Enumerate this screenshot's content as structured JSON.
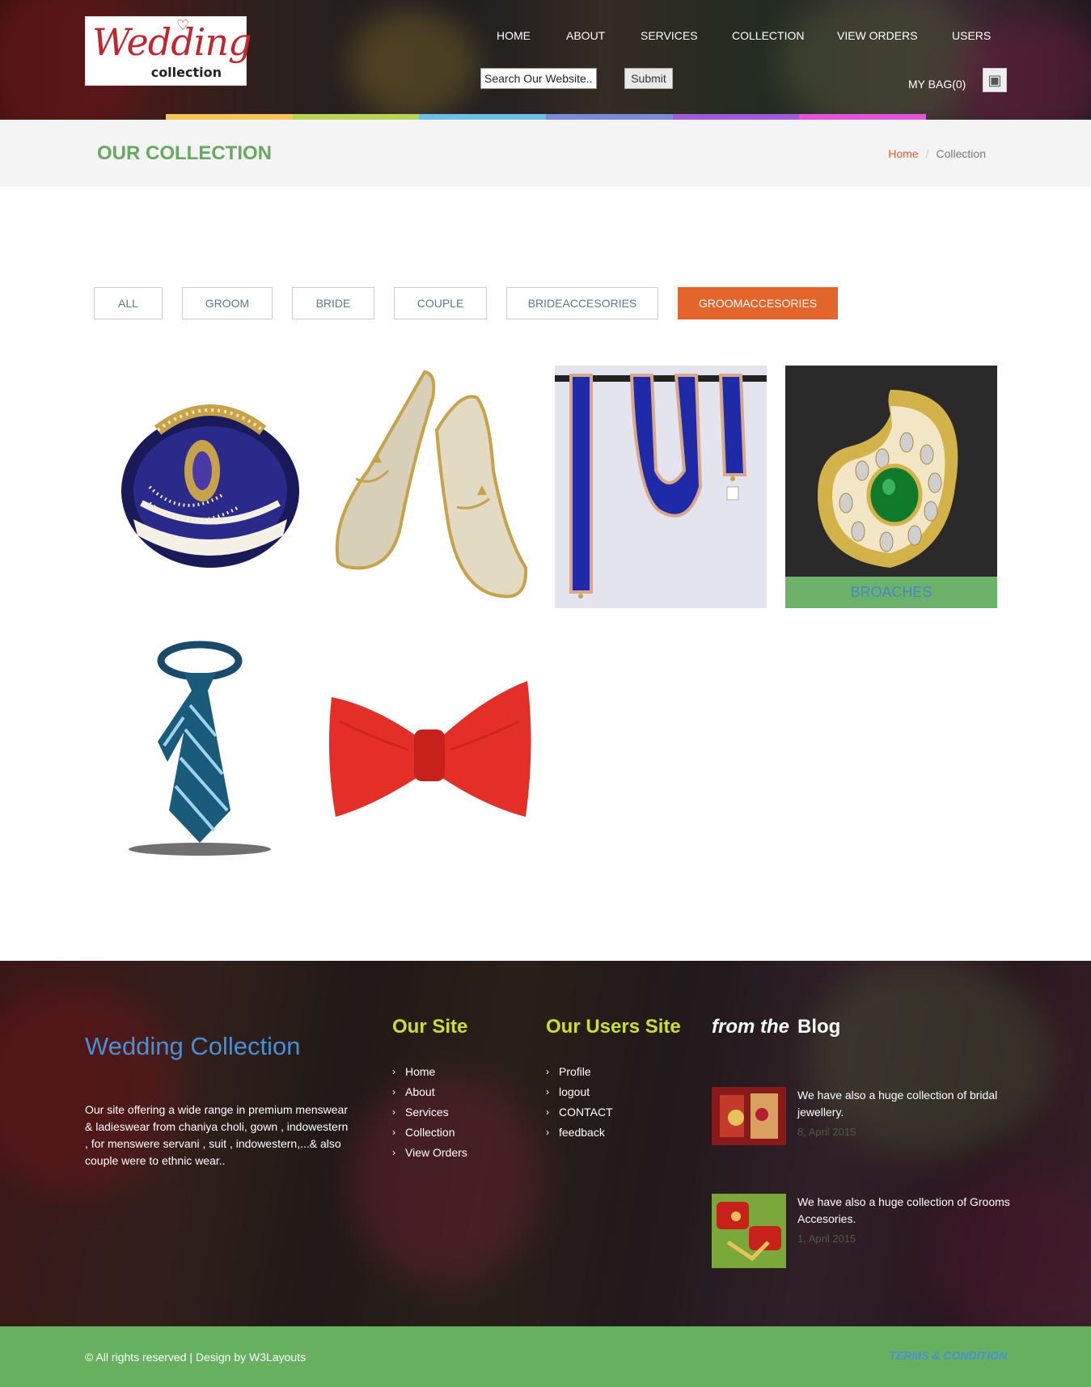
{
  "header": {
    "logo_text": "Wedding",
    "logo_subtext": "collection",
    "nav": [
      {
        "label": "HOME"
      },
      {
        "label": "ABOUT"
      },
      {
        "label": "SERVICES"
      },
      {
        "label": "COLLECTION"
      },
      {
        "label": "VIEW ORDERS"
      },
      {
        "label": "USERS"
      }
    ],
    "search_placeholder": "Search Our Website...",
    "submit_label": "Submit",
    "bag_label": "MY BAG(0)",
    "strip_colors": [
      "#f5c55b",
      "#b8d356",
      "#6cc0e8",
      "#7b8bd8",
      "#a05bd6",
      "#e156d6"
    ]
  },
  "title_bar": {
    "title": "OUR COLLECTION",
    "breadcrumb": {
      "home": "Home",
      "separator": "/",
      "current": "Collection"
    }
  },
  "filters": [
    {
      "label": "ALL",
      "active": false
    },
    {
      "label": "GROOM",
      "active": false
    },
    {
      "label": "BRIDE",
      "active": false
    },
    {
      "label": "COUPLE",
      "active": false
    },
    {
      "label": "BRIDEACCESORIES",
      "active": false
    },
    {
      "label": "GROOMACCESORIES",
      "active": true
    }
  ],
  "products": [
    {
      "name": "turban-image"
    },
    {
      "name": "mojari-shoes-image"
    },
    {
      "name": "velvet-stole-image"
    },
    {
      "name": "broach-image",
      "caption": "BROACHES"
    },
    {
      "name": "tie-image"
    },
    {
      "name": "bow-tie-image"
    }
  ],
  "footer": {
    "brand": "Wedding Collection",
    "about": "Our site offering a wide range in premium menswear & ladieswear from chaniya choli, gown , indowestern , for menswere servani , suit , indowestern,...& also couple were to ethnic wear..",
    "our_site": {
      "heading": "Our Site",
      "links": [
        "Home",
        "About",
        "Services",
        "Collection",
        "View Orders"
      ]
    },
    "users_site": {
      "heading": "Our Users Site",
      "links": [
        "Profile",
        "logout",
        "CONTACT",
        "feedback"
      ]
    },
    "blog": {
      "heading_italic": "from the",
      "heading": "Blog",
      "posts": [
        {
          "text": "We have also a huge collection of bridal jewellery.",
          "date": "8, April 2015"
        },
        {
          "text": "We have also a huge collection of Grooms Accesories.",
          "date": "1, April 2015"
        }
      ]
    }
  },
  "bottom_bar": {
    "copyright": "© All rights reserved | Design by W3Layouts",
    "terms": "TERMS & CONDITION"
  },
  "colors": {
    "accent_orange": "#e3652b",
    "green": "#66b060",
    "title_green": "#68a861",
    "brand_blue": "#4a8fd4",
    "footer_heading": "#c9e02e"
  }
}
